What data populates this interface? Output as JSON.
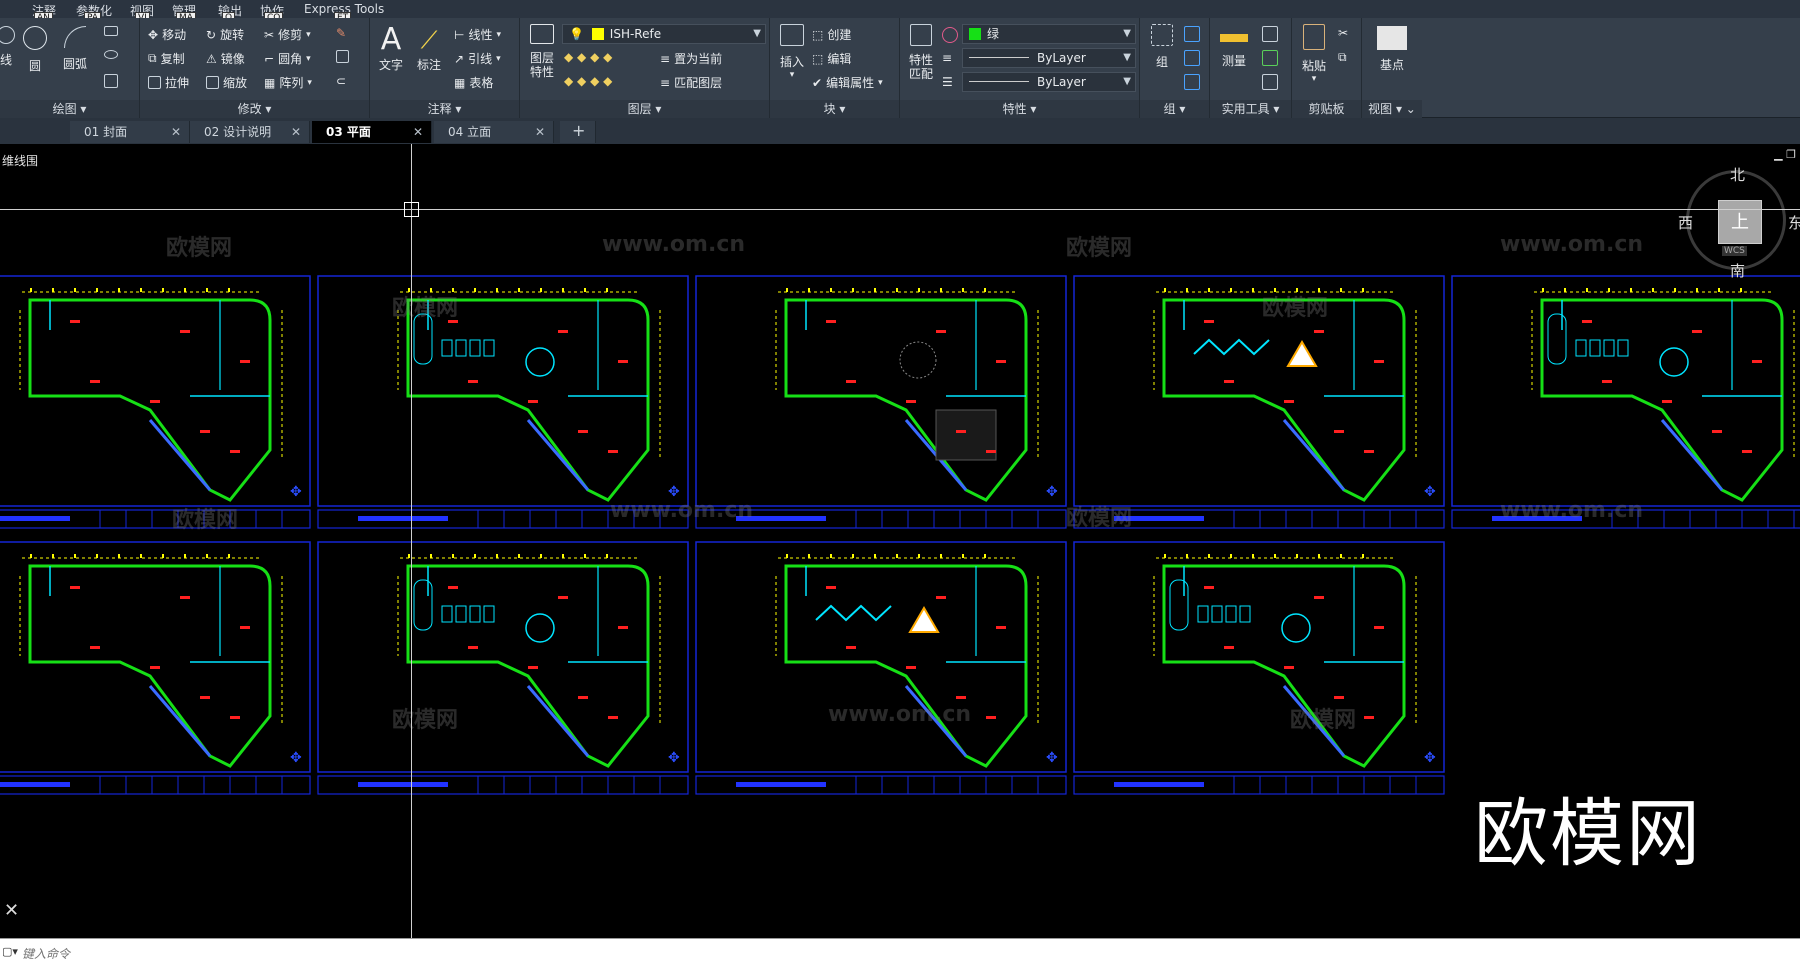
{
  "ribbon": {
    "tabs": [
      {
        "label": "注释",
        "key": "AN"
      },
      {
        "label": "参数化",
        "key": "PA"
      },
      {
        "label": "视图",
        "key": "VI"
      },
      {
        "label": "管理",
        "key": "MA"
      },
      {
        "label": "输出",
        "key": "O"
      },
      {
        "label": "协作",
        "key": "CO"
      },
      {
        "label": "Express Tools",
        "key": "ET"
      }
    ],
    "extra_keys": [
      "X2",
      "X3"
    ],
    "draw": {
      "title": "绘图",
      "line": "线",
      "circle": "圆",
      "arc": "圆弧"
    },
    "modify": {
      "title": "修改",
      "move": "移动",
      "rotate": "旋转",
      "trim": "修剪",
      "copy": "复制",
      "mirror": "镜像",
      "fillet": "圆角",
      "stretch": "拉伸",
      "scale": "缩放",
      "array": "阵列"
    },
    "annotation": {
      "title": "注释",
      "text": "文字",
      "dim": "标注",
      "linear": "线性",
      "leader": "引线",
      "table": "表格"
    },
    "layers": {
      "title": "图层",
      "props": "图层\n特性",
      "current_layer": "ISH-Refe",
      "make_current": "置为当前",
      "match_layer": "匹配图层"
    },
    "block": {
      "title": "块",
      "insert": "插入",
      "create": "创建",
      "edit": "编辑",
      "edit_attr": "编辑属性"
    },
    "properties": {
      "title": "特性",
      "match": "特性\n匹配",
      "color": "绿",
      "color_hex": "#16e016",
      "linetype": "ByLayer",
      "lineweight": "ByLayer"
    },
    "groups": {
      "title": "组",
      "group": "组"
    },
    "utilities": {
      "title": "实用工具",
      "measure": "测量"
    },
    "clipboard": {
      "title": "剪贴板",
      "paste": "粘贴"
    },
    "view": {
      "title": "视图",
      "base": "基点"
    }
  },
  "doc_tabs": [
    {
      "label": "01 封面",
      "active": false
    },
    {
      "label": "02 设计说明",
      "active": false
    },
    {
      "label": "03 平面",
      "active": true
    },
    {
      "label": "04 立面",
      "active": false
    }
  ],
  "viewport": {
    "label": "维线围",
    "viewcube": {
      "north": "北",
      "south": "南",
      "west": "西",
      "east": "东",
      "face": "上",
      "wcs": "WCS"
    },
    "watermark_url": "www.om.cn",
    "watermark_name": "欧模网",
    "brand": "欧模网"
  },
  "command": {
    "placeholder": "键入命令"
  },
  "colors": {
    "frame": "#1426d6",
    "wall": "#16e016",
    "furniture": "#00e5ff",
    "accent": "#ff2020",
    "dim": "#ffff00",
    "ribbon": "#353f4b"
  }
}
